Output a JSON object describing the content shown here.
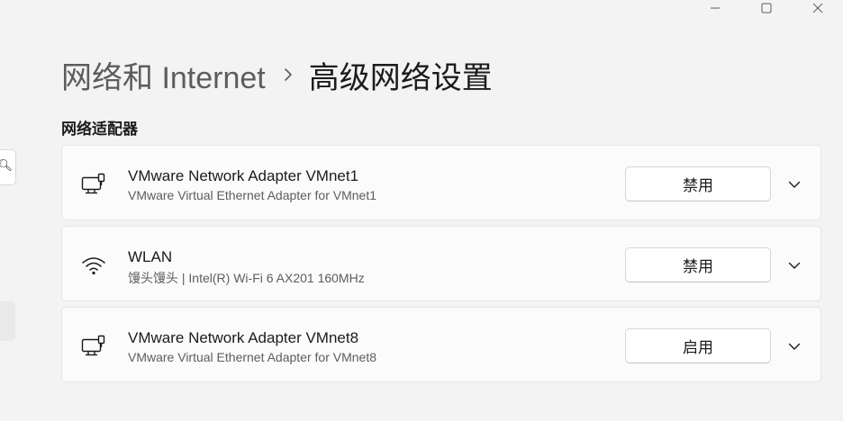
{
  "window": {
    "controls": [
      "minimize-icon",
      "maximize-icon",
      "close-icon"
    ]
  },
  "breadcrumb": {
    "parent": "网络和 Internet",
    "separator_icon": "chevron-right-icon",
    "current": "高级网络设置"
  },
  "section": {
    "title": "网络适配器"
  },
  "adapters": [
    {
      "name": "VMware Network Adapter VMnet1",
      "description": "VMware Virtual Ethernet Adapter for VMnet1",
      "icon": "ethernet-icon",
      "button_label": "禁用"
    },
    {
      "name": "WLAN",
      "description": "馒头馒头 | Intel(R) Wi-Fi 6 AX201 160MHz",
      "icon": "wifi-icon",
      "button_label": "禁用"
    },
    {
      "name": "VMware Network Adapter VMnet8",
      "description": "VMware Virtual Ethernet Adapter for VMnet8",
      "icon": "ethernet-icon",
      "button_label": "启用"
    }
  ],
  "colors": {
    "background": "#f3f3f3",
    "card": "#fbfbfb",
    "text_primary": "#1b1b1b",
    "text_secondary": "#5d5d5d"
  }
}
